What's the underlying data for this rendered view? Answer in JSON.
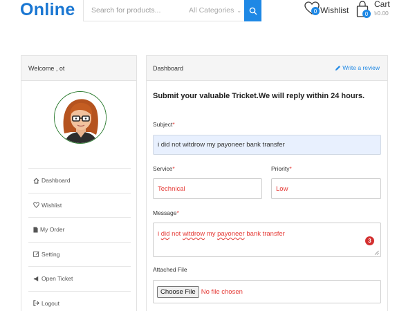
{
  "header": {
    "logo": "Online",
    "search": {
      "placeholder": "Search for products..."
    },
    "category": {
      "selected": "All Categories"
    },
    "wishlist": {
      "label": "Wishlist",
      "count": "0"
    },
    "cart": {
      "label": "Cart",
      "amount": "৳0.00",
      "count": "0"
    }
  },
  "sidebar": {
    "welcome": "Welcome , ot",
    "items": [
      {
        "label": "Dashboard",
        "icon": "home-icon"
      },
      {
        "label": "Wishlist",
        "icon": "heart-icon"
      },
      {
        "label": "My Order",
        "icon": "file-icon"
      },
      {
        "label": "Setting",
        "icon": "edit-icon"
      },
      {
        "label": "Open Ticket",
        "icon": "megaphone-icon"
      },
      {
        "label": "Logout",
        "icon": "logout-icon"
      }
    ]
  },
  "main": {
    "title": "Dashboard",
    "review_link": "Write a review",
    "headline": "Submit your valuable Tricket.We will reply within 24 hours.",
    "form": {
      "subject": {
        "label": "Subject",
        "value": "i did not witdrow my payoneer bank transfer"
      },
      "service": {
        "label": "Service",
        "value": "Technical"
      },
      "priority": {
        "label": "Priority",
        "value": "Low"
      },
      "message": {
        "label": "Message",
        "parts": [
          "i ",
          "did",
          " not ",
          "witdrow",
          " my ",
          "payoneer",
          " bank transfer"
        ],
        "badge": "3"
      },
      "attachment": {
        "label": "Attached File",
        "button": "Choose File",
        "status": "No file chosen"
      }
    }
  },
  "colors": {
    "brand": "#1976d2",
    "accent": "#1e88e5",
    "required": "#e53935"
  }
}
